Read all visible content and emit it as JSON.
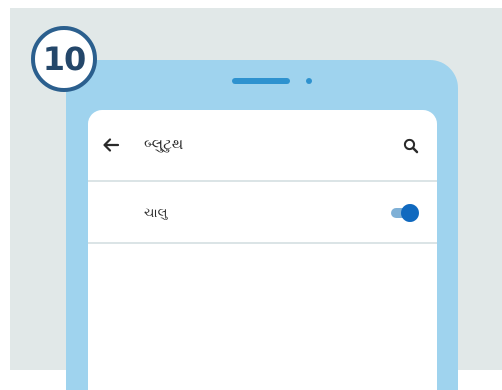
{
  "step": {
    "number": "10"
  },
  "app_bar": {
    "back_icon": "arrow-left-icon",
    "title": "બ્લુટુથ",
    "search_icon": "search-icon"
  },
  "bluetooth_row": {
    "label": "ચાલુ",
    "toggle_state": "on"
  },
  "colors": {
    "background_panel": "#e1e8e8",
    "step_border": "#2b5f8e",
    "step_text": "#24476a",
    "phone_body": "#9fd3ee",
    "phone_accent": "#2e92cf",
    "toggle_on": "#1069bf",
    "toggle_track": "#7fb0d6",
    "divider": "#dbe4e6"
  }
}
